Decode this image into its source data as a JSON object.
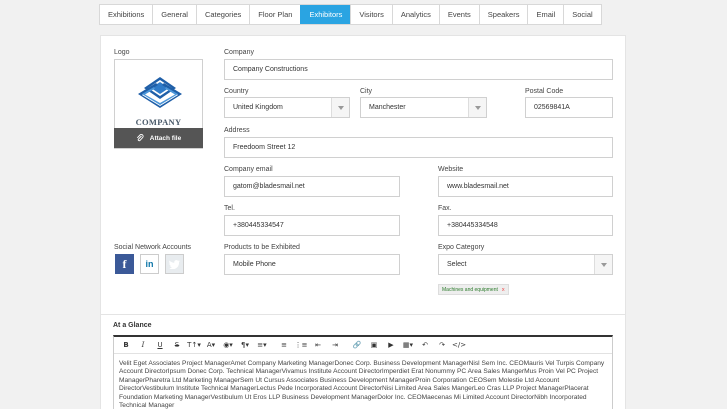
{
  "tabs": [
    {
      "label": "Exhibitions",
      "active": false
    },
    {
      "label": "General",
      "active": false
    },
    {
      "label": "Categories",
      "active": false
    },
    {
      "label": "Floor Plan",
      "active": false
    },
    {
      "label": "Exhibitors",
      "active": true
    },
    {
      "label": "Visitors",
      "active": false
    },
    {
      "label": "Analytics",
      "active": false
    },
    {
      "label": "Events",
      "active": false
    },
    {
      "label": "Speakers",
      "active": false
    },
    {
      "label": "Email",
      "active": false
    },
    {
      "label": "Social",
      "active": false
    }
  ],
  "logo": {
    "label": "Logo",
    "company_text": "COMPANY",
    "attach_label": "Attach file"
  },
  "form": {
    "company": {
      "label": "Company",
      "value": "Company Constructions"
    },
    "country": {
      "label": "Country",
      "value": "United Kingdom"
    },
    "city": {
      "label": "City",
      "value": "Manchester"
    },
    "postal": {
      "label": "Postal Code",
      "value": "02569841A"
    },
    "address": {
      "label": "Address",
      "value": "Freedoom Street 12"
    },
    "email": {
      "label": "Company email",
      "value": "gatom@bladesmail.net"
    },
    "website": {
      "label": "Website",
      "value": "www.bladesmail.net"
    },
    "tel": {
      "label": "Tel.",
      "value": "+380445334547"
    },
    "fax": {
      "label": "Fax.",
      "value": "+380445334548"
    },
    "social_label": "Social Network Accounts",
    "products": {
      "label": "Products to be Exhibited",
      "value": "Mobile Phone"
    },
    "expo": {
      "label": "Expo Category",
      "value": "Select"
    },
    "tag": {
      "label": "Machines and equipment",
      "remove": "x"
    }
  },
  "glance": {
    "title": "At a Glance",
    "text": "Velit Eget Associates Project ManagerAmet Company Marketing ManagerDonec Corp. Business Development ManagerNisl Sem Inc. CEOMauris Vel Turpis Company Account DirectorIpsum Donec Corp. Technical ManagerVivamus Institute Account DirectorImperdiet Erat Nonummy PC Area Sales MangerMus Proin Vel PC Project ManagerPharetra Ltd Marketing ManagerSem Ut Cursus Associates Business Development ManagerProin Corporation CEOSem Molestie Ltd Account DirectorVestibulum Institute Technical ManagerLectus Pede Incorporated Account DirectorNisi Limited Area Sales MangerLeo Cras LLP Project ManagerPlacerat Foundation Marketing ManagerVestibulum Ut Eros LLP Business Development ManagerDolor Inc. CEOMaecenas Mi Limited Account DirectorNibh Incorporated Technical Manager"
  },
  "social": {
    "facebook": "f",
    "linkedin": "in"
  },
  "colors": {
    "accent": "#2aa4e2",
    "facebook": "#3b5998",
    "linkedin": "#0e76a8"
  }
}
